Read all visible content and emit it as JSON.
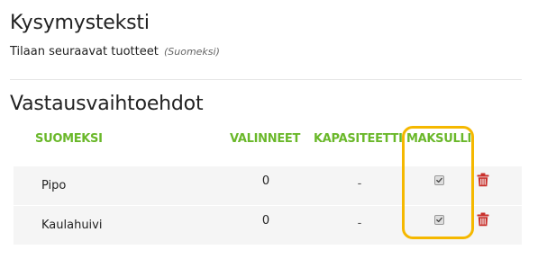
{
  "question": {
    "title": "Kysymysteksti",
    "text": "Tilaan seuraavat tuotteet",
    "language": "(Suomeksi)"
  },
  "answers": {
    "title": "Vastausvaihtoehdot",
    "columns": {
      "language": "SUOMEKSI",
      "selections": "VALINNEET",
      "capacity": "KAPASITEETTI",
      "paid": "MAKSULLI"
    },
    "rows": [
      {
        "name": "Pipo",
        "selections": "0",
        "capacity": "-",
        "paid": true
      },
      {
        "name": "Kaulahuivi",
        "selections": "0",
        "capacity": "-",
        "paid": true
      }
    ]
  },
  "colors": {
    "header_green": "#6ab82a",
    "delete_red": "#c9302c",
    "highlight": "#f5b800",
    "row_bg": "#f5f5f5"
  },
  "icons": {
    "checkbox": "checkbox-checked-icon",
    "delete": "trash-icon"
  }
}
